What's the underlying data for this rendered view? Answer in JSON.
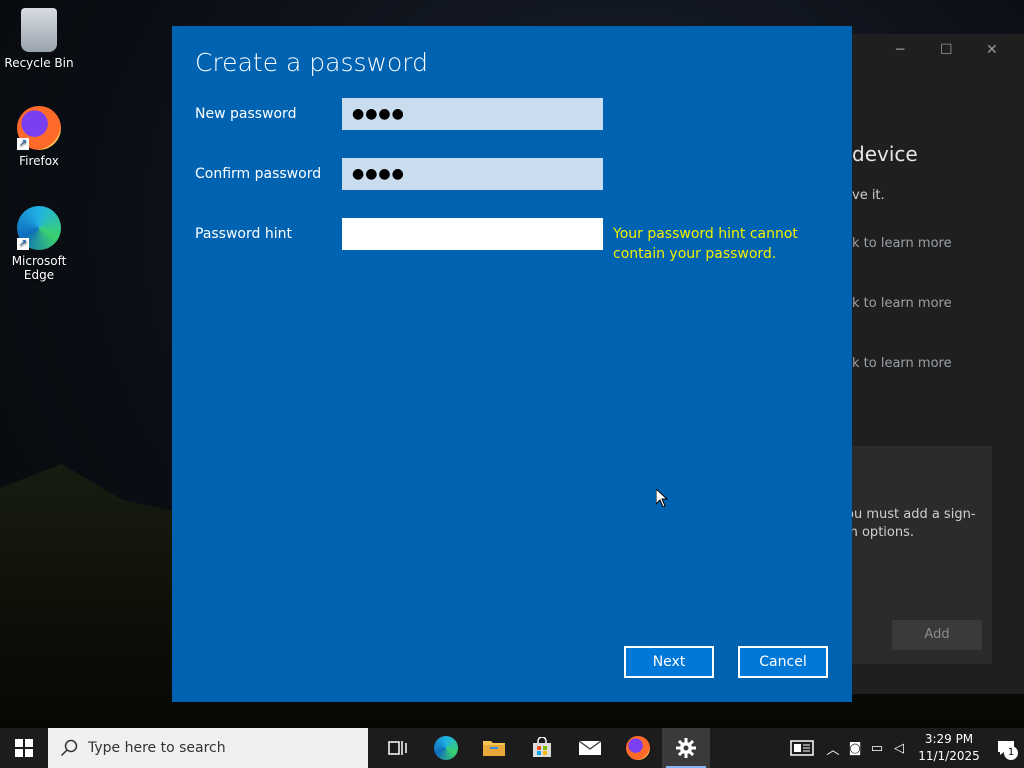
{
  "desktop": {
    "icons": [
      {
        "label": "Recycle Bin",
        "icon": "recycle-bin-icon"
      },
      {
        "label": "Firefox",
        "icon": "firefox-icon"
      },
      {
        "label": "Microsoft Edge",
        "icon": "edge-icon"
      }
    ]
  },
  "background_window": {
    "heading_fragment": "device",
    "sub_fragment": "ve it.",
    "learn_more_fragments": [
      "k to learn more",
      "k to learn more",
      "k to learn more"
    ],
    "card_text_fragment": "ou must add a sign-in options.",
    "add_button_label": "Add"
  },
  "dialog": {
    "title": "Create a password",
    "new_password": {
      "label": "New password",
      "value": "●●●●"
    },
    "confirm_password": {
      "label": "Confirm password",
      "value": "●●●●"
    },
    "password_hint": {
      "label": "Password hint",
      "value": ""
    },
    "hint_error": "Your password hint cannot contain your password.",
    "next_label": "Next",
    "cancel_label": "Cancel",
    "background_color": "#0063b1",
    "error_color": "#f4f000"
  },
  "taskbar": {
    "search_placeholder": "Type here to search",
    "apps": [
      "task-view-icon",
      "edge-icon",
      "file-explorer-icon",
      "store-icon",
      "mail-icon",
      "firefox-icon",
      "settings-icon"
    ],
    "active_app": "settings-icon",
    "time": "3:29 PM",
    "date": "11/1/2025",
    "notification_count": "1"
  }
}
